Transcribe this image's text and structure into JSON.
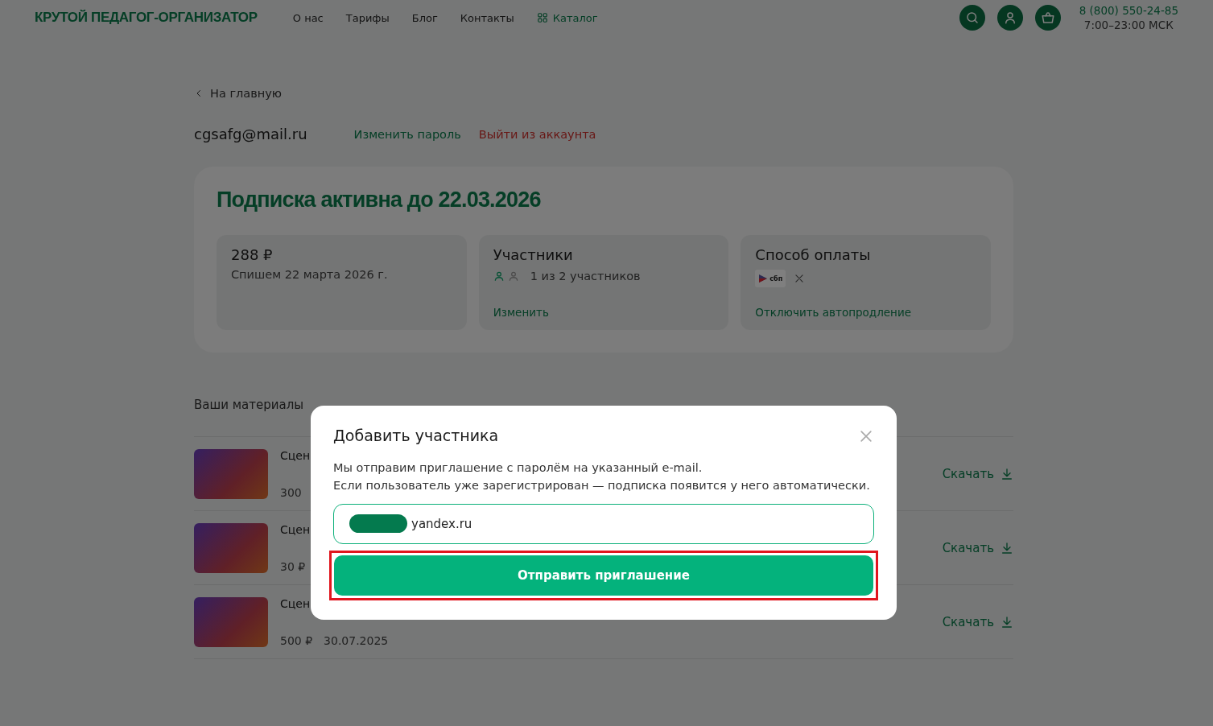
{
  "header": {
    "logo": "КРУТОЙ ПЕДАГОГ-ОРГАНИЗАТОР",
    "nav": [
      {
        "label": "О нас",
        "kind": "link"
      },
      {
        "label": "Тарифы",
        "kind": "link"
      },
      {
        "label": "Блог",
        "kind": "link"
      },
      {
        "label": "Контакты",
        "kind": "link"
      },
      {
        "label": "Каталог",
        "kind": "catalog"
      }
    ],
    "phone": "8 (800) 550-24-85",
    "hours": "7:00–23:00 МСК"
  },
  "back_link": "На главную",
  "account": {
    "email": "cgsafg@mail.ru",
    "change_password": "Изменить пароль",
    "logout": "Выйти из аккаунта"
  },
  "subscription": {
    "title": "Подписка активна до 22.03.2026",
    "price": "288 ₽",
    "charge_note": "Спишем 22 марта 2026 г.",
    "participants": {
      "title": "Участники",
      "slots": [
        {
          "filled": true
        },
        {
          "filled": false
        }
      ],
      "count": "1 из 2 участников",
      "action": "Изменить"
    },
    "payment": {
      "title": "Способ оплаты",
      "logo_text": "сбп",
      "action": "Отключить автопродление"
    }
  },
  "materials": {
    "title": "Ваши материалы",
    "items": [
      {
        "title": "Сцен",
        "price": "300",
        "download": "Скачать"
      },
      {
        "title": "Сцен",
        "price": "30 ₽",
        "download": "Скачать"
      },
      {
        "title": "Сцен",
        "price": "500 ₽",
        "date": "30.07.2025",
        "download": "Скачать"
      }
    ]
  },
  "modal": {
    "title": "Добавить участника",
    "lines": [
      "Мы отправим приглашение с паролём на указанный e-mail.",
      "Если пользователь уже зарегистрирован — подписка появится у него автоматически."
    ],
    "email_value": "yandex.ru",
    "redacted": true,
    "submit": "Отправить приглашение",
    "highlighted": true
  }
}
